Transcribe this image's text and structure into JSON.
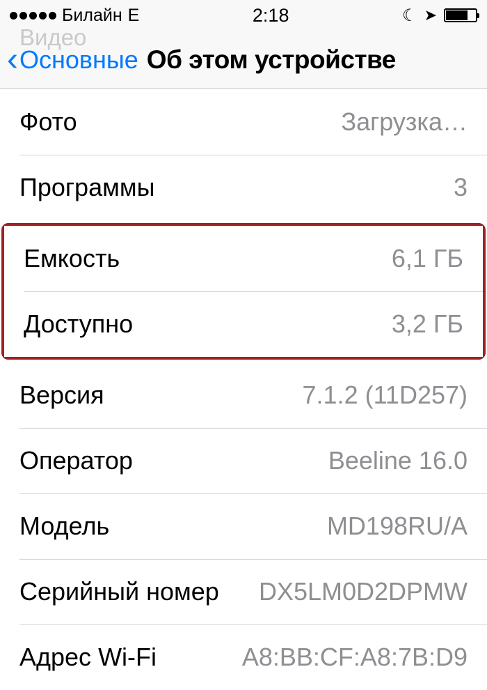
{
  "status": {
    "carrier": "Билайн",
    "network": "E",
    "time": "2:18"
  },
  "nav": {
    "ghost": "Видео",
    "back": "Основные",
    "title": "Об этом устройстве"
  },
  "rows": {
    "photo": {
      "label": "Фото",
      "value": "Загрузка…"
    },
    "apps": {
      "label": "Программы",
      "value": "3"
    },
    "capacity": {
      "label": "Емкость",
      "value": "6,1 ГБ"
    },
    "available": {
      "label": "Доступно",
      "value": "3,2 ГБ"
    },
    "version": {
      "label": "Версия",
      "value": "7.1.2 (11D257)"
    },
    "carrier": {
      "label": "Оператор",
      "value": "Beeline 16.0"
    },
    "model": {
      "label": "Модель",
      "value": "MD198RU/A"
    },
    "serial": {
      "label": "Серийный номер",
      "value": "DX5LM0D2DPMW"
    },
    "wifi": {
      "label": "Адрес Wi-Fi",
      "value": "A8:BB:CF:A8:7B:D9"
    }
  }
}
